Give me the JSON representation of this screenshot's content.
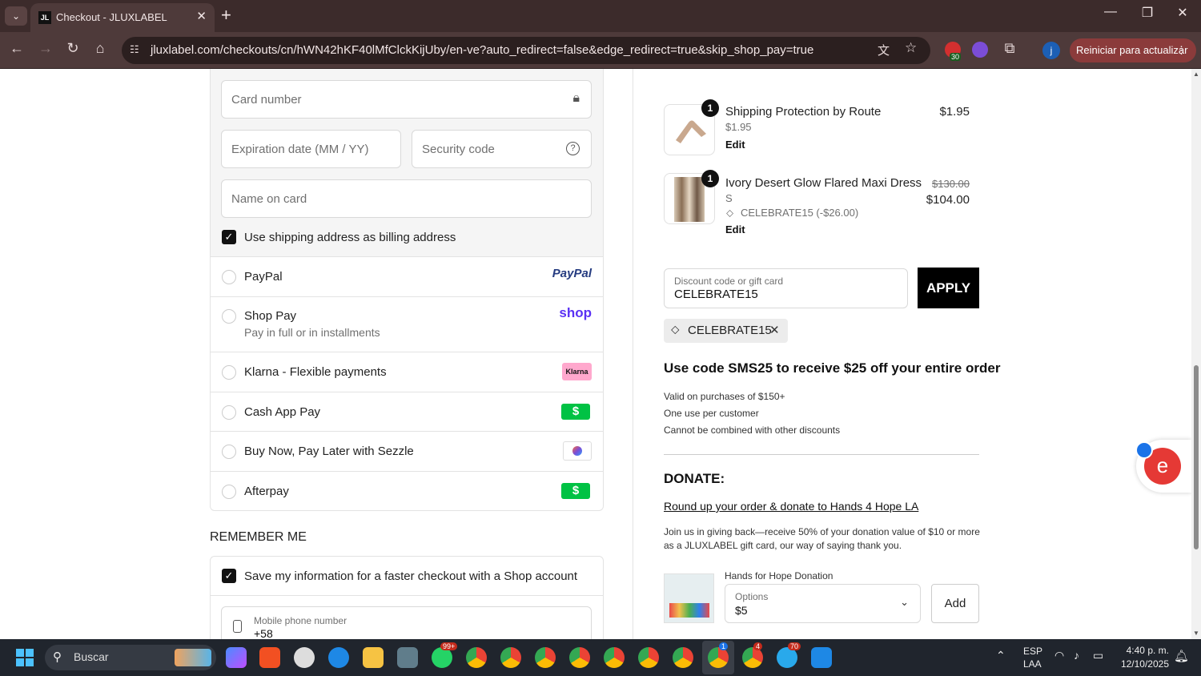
{
  "browser": {
    "tab_title": "Checkout - JLUXLABEL",
    "tab_favicon": "JL",
    "url": "jluxlabel.com/checkouts/cn/hWN42hKF40lMfClckKijUby/en-ve?auto_redirect=false&edge_redirect=true&skip_shop_pay=true",
    "update_button": "Reiniciar para actualizar",
    "extension_badge": "30",
    "profile_initial": "j",
    "icons": [
      "tab-search-icon",
      "close-icon",
      "plus-icon",
      "minimize-icon",
      "restore-icon",
      "back-icon",
      "forward-icon",
      "reload-icon",
      "home-icon",
      "site-info-icon",
      "translate-icon",
      "star-icon",
      "extensions-icon",
      "more-icon"
    ]
  },
  "payment": {
    "card_number_placeholder": "Card number",
    "expiration_placeholder": "Expiration date (MM / YY)",
    "security_placeholder": "Security code",
    "name_placeholder": "Name on card",
    "billing_checkbox_label": "Use shipping address as billing address",
    "methods": [
      {
        "label": "PayPal",
        "logo": "PayPal"
      },
      {
        "label": "Shop Pay",
        "sub": "Pay in full or in installments",
        "logo": "shop"
      },
      {
        "label": "Klarna - Flexible payments",
        "logo": "Klarna"
      },
      {
        "label": "Cash App Pay",
        "logo": "$"
      },
      {
        "label": "Buy Now, Pay Later with Sezzle",
        "logo": "sezzle-icon"
      },
      {
        "label": "Afterpay",
        "logo": "$"
      }
    ]
  },
  "remember": {
    "heading": "REMEMBER ME",
    "save_label": "Save my information for a faster checkout with a Shop account",
    "phone_label": "Mobile phone number",
    "phone_value": "+58"
  },
  "order": {
    "items": [
      {
        "qty": "1",
        "name": "Shipping Protection by Route",
        "variant": "$1.95",
        "price": "$1.95",
        "edit": "Edit"
      },
      {
        "qty": "1",
        "name": "Ivory Desert Glow Flared Maxi Dress",
        "variant": "S",
        "discount": "CELEBRATE15 (-$26.00)",
        "old_price": "$130.00",
        "price": "$104.00",
        "edit": "Edit"
      }
    ],
    "discount_label": "Discount code or gift card",
    "discount_value": "CELEBRATE15",
    "apply": "APPLY",
    "applied_code": "CELEBRATE15",
    "promo_heading": "Use code SMS25 to receive $25 off your entire order",
    "promo_lines": [
      "Valid on purchases of $150+",
      "One use per customer",
      "Cannot be combined with other discounts"
    ],
    "donate_heading": "DONATE:",
    "donate_link": "Round up your order & donate to Hands 4 Hope LA",
    "donate_text_1": "Join us in giving back—receive 50% of your donation value of $10 or more",
    "donate_text_2": "as a JLUXLABEL gift card, our way of saying thank you.",
    "donation_product": "Hands for Hope Donation",
    "options_label": "Options",
    "options_value": "$5",
    "add_button": "Add"
  },
  "taskbar": {
    "search_placeholder": "Buscar",
    "badge_whatsapp": "99+",
    "badge_chrome": "1",
    "badge_chrome2": "4",
    "badge_telegram": "70",
    "lang_1": "ESP",
    "lang_2": "LAA",
    "time": "4:40 p. m.",
    "date": "12/10/2025"
  },
  "colors": {
    "tab_bg": "#3c2b2b",
    "toolbar": "#4e3a3a",
    "accent_green": "#00c244",
    "shop_purple": "#5a31f4",
    "paypal": "#253b80"
  }
}
